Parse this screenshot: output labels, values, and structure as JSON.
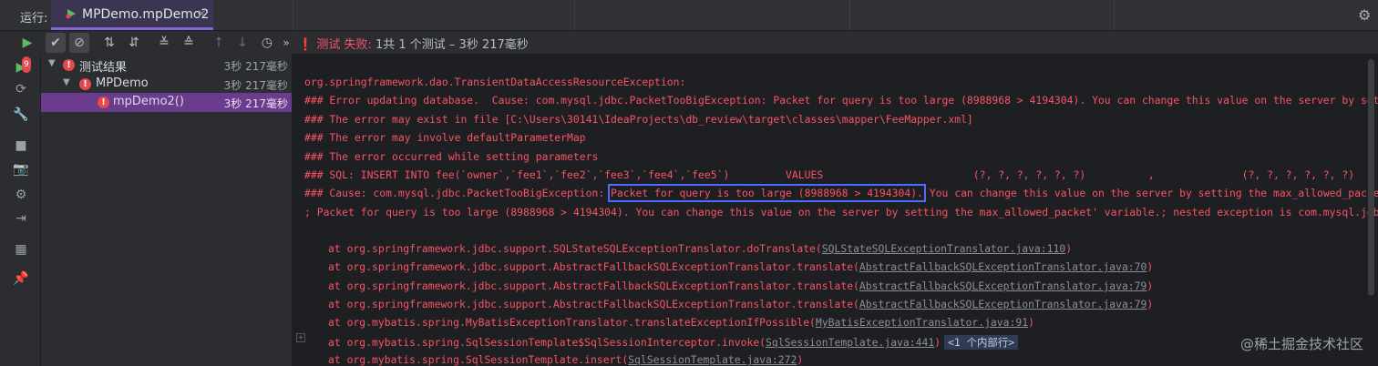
{
  "topbar": {
    "run_label": "运行:",
    "tab_title": "MPDemo.mpDemo2",
    "tab_close": "×"
  },
  "toolbar": {
    "status_failed": "测试 失败:",
    "status_summary": "1共 1 个测试 – 3秒 217毫秒",
    "more": "»"
  },
  "strip": {
    "badge_count": "9"
  },
  "tree": [
    {
      "label": "测试结果",
      "time": "3秒 217毫秒"
    },
    {
      "label": "MPDemo",
      "time": "3秒 217毫秒"
    },
    {
      "label": "mpDemo2()",
      "time": "3秒 217毫秒"
    }
  ],
  "console": {
    "lines": [
      "org.springframework.dao.TransientDataAccessResourceException:",
      "### Error updating database.  Cause: com.mysql.jdbc.PacketTooBigException: Packet for query is too large (8988968 > 4194304). You can change this value on the server by setting the",
      "### The error may exist in file [C:\\Users\\30141\\IdeaProjects\\db_review\\target\\classes\\mapper\\FeeMapper.xml]",
      "### The error may involve defaultParameterMap",
      "### The error occurred while setting parameters",
      "### SQL: INSERT INTO fee(`owner`,`fee1`,`fee2`,`fee3`,`fee4`,`fee5`)         VALUES                        (?, ?, ?, ?, ?, ?)          ,              (?, ?, ?, ?, ?, ?)          ,",
      "; Packet for query is too large (8988968 > 4194304). You can change this value on the server by setting the max_allowed_packet' variable.; nested exception is com.mysql.jdbc.Packet"
    ],
    "cause_prefix": "### Cause: com.mysql.jdbc.PacketTooBigException: ",
    "cause_highlight": "Packet for query is too large (8988968 > 4194304).",
    "cause_suffix": " You can change this value on the server by setting the max_allowed_packet' varia",
    "trace": [
      {
        "text": "at org.springframework.jdbc.support.SQLStateSQLExceptionTranslator.doTranslate(",
        "link": "SQLStateSQLExceptionTranslator.java:110",
        "end": ")"
      },
      {
        "text": "at org.springframework.jdbc.support.AbstractFallbackSQLExceptionTranslator.translate(",
        "link": "AbstractFallbackSQLExceptionTranslator.java:70",
        "end": ")"
      },
      {
        "text": "at org.springframework.jdbc.support.AbstractFallbackSQLExceptionTranslator.translate(",
        "link": "AbstractFallbackSQLExceptionTranslator.java:79",
        "end": ")"
      },
      {
        "text": "at org.springframework.jdbc.support.AbstractFallbackSQLExceptionTranslator.translate(",
        "link": "AbstractFallbackSQLExceptionTranslator.java:79",
        "end": ")"
      },
      {
        "text": "at org.mybatis.spring.MyBatisExceptionTranslator.translateExceptionIfPossible(",
        "link": "MyBatisExceptionTranslator.java:91",
        "end": ")"
      },
      {
        "text": "at org.mybatis.spring.SqlSessionTemplate$SqlSessionInterceptor.invoke(",
        "link": "SqlSessionTemplate.java:441",
        "end": ")"
      },
      {
        "text": "at org.mybatis.spring.SqlSessionTemplate.insert(",
        "link": "SqlSessionTemplate.java:272",
        "end": ")"
      }
    ],
    "internal_chip": "<1 个内部行>",
    "watermark": "@稀土掘金技术社区"
  },
  "colors": {
    "error": "#f75464",
    "accent": "#8a63d2",
    "selection": "#6b3c8e",
    "highlight_box": "#4d6bff"
  }
}
